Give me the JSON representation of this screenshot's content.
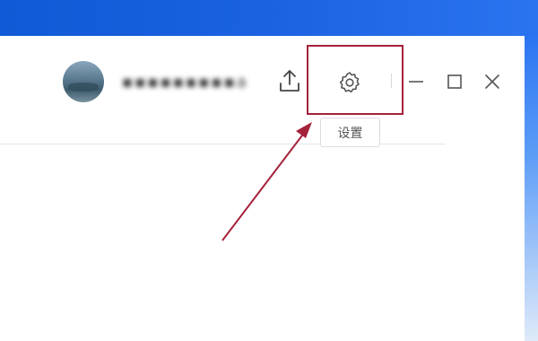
{
  "header": {
    "username": "▪▪▪▪▪▪▪▪▪anad",
    "avatar_label": "user avatar"
  },
  "toolbar": {
    "upload_icon": "upload-icon",
    "settings_icon": "gear-icon",
    "settings_tooltip": "设置",
    "minimize_icon": "minimize-icon",
    "maximize_icon": "maximize-icon",
    "close_icon": "close-icon"
  },
  "annotation": {
    "highlight_color": "#a4223a",
    "arrow_color": "#a4223a"
  },
  "colors": {
    "desktop_blue": "#1a62e0",
    "icon_color": "#444444"
  }
}
